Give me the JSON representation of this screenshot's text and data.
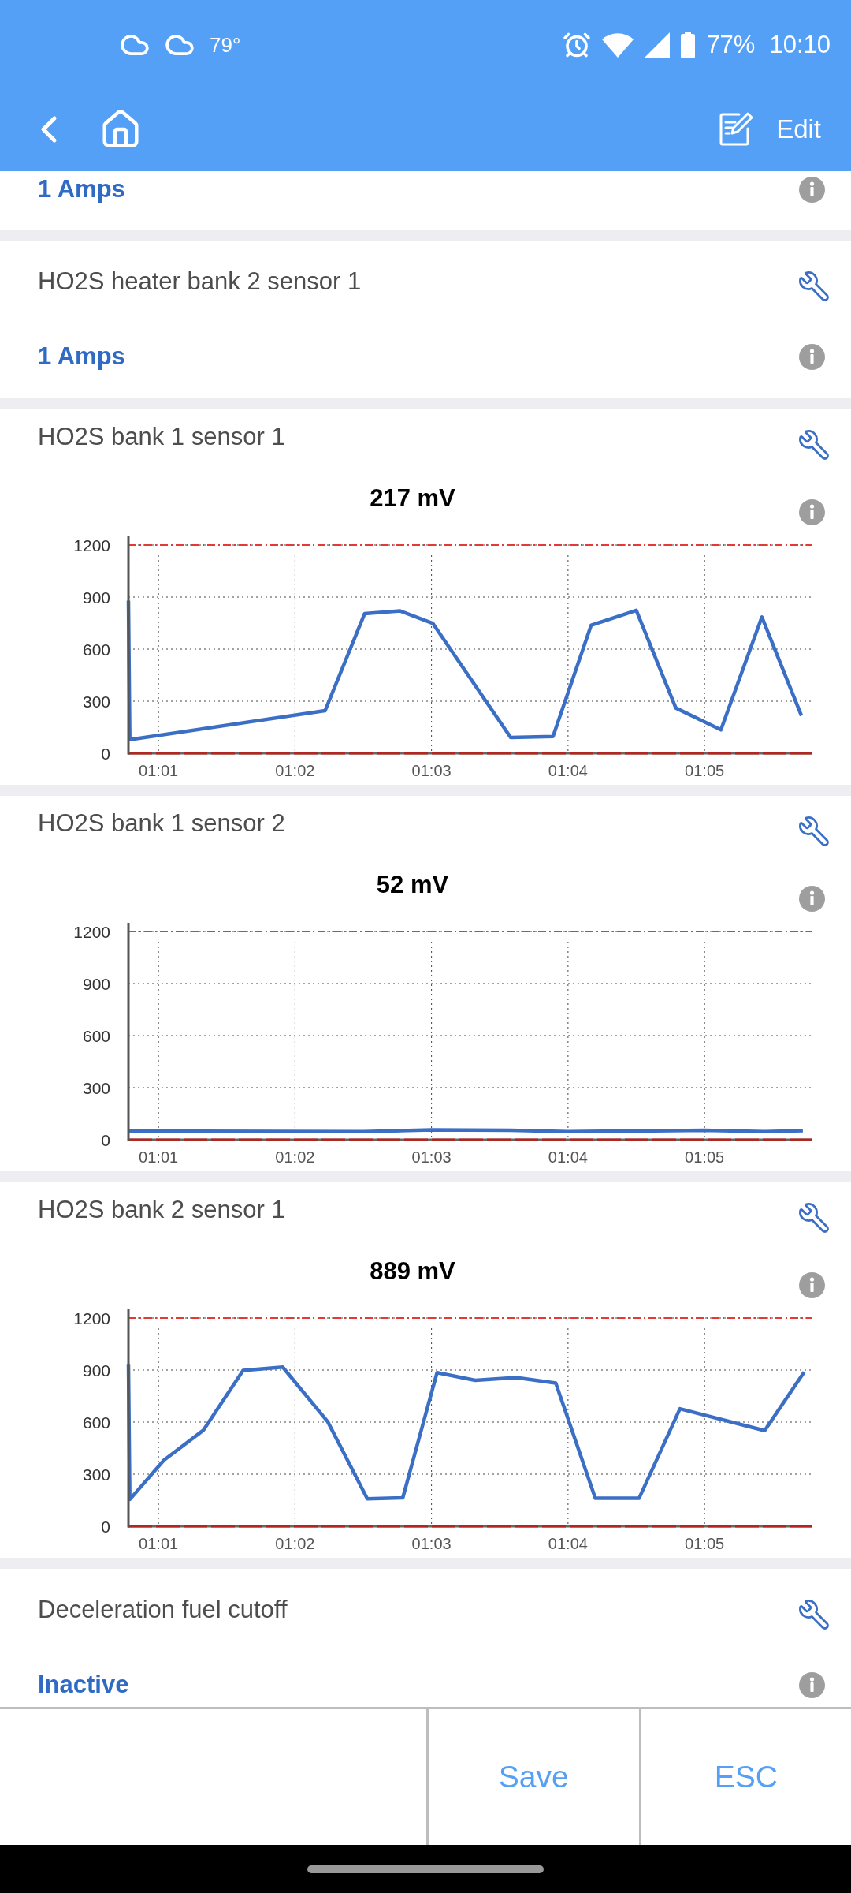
{
  "status_bar": {
    "temperature": "79°",
    "battery": "77%",
    "time": "10:10"
  },
  "toolbar": {
    "edit_label": "Edit"
  },
  "sensors": [
    {
      "kind": "value",
      "value": "1 Amps"
    },
    {
      "kind": "value",
      "title": "HO2S heater bank 2 sensor 1",
      "value": "1 Amps"
    },
    {
      "kind": "chart",
      "title": "HO2S bank 1 sensor 1",
      "reading": "217 mV",
      "chart_data": {
        "type": "line",
        "x": [
          60.78,
          60.79,
          62.22,
          62.51,
          62.77,
          63.01,
          63.58,
          63.89,
          64.17,
          64.5,
          64.79,
          65.12,
          65.42,
          65.71
        ],
        "series": [
          {
            "color": "#3b6fc6",
            "values": [
              880,
              78,
              245,
              804,
              820,
              748,
              91,
              97,
              738,
              823,
              261,
              135,
              785,
              217
            ]
          }
        ],
        "xlim": [
          60.78,
          65.79
        ],
        "ylim": [
          0,
          1250
        ],
        "xticks": [
          {
            "value": 61,
            "label": "01:01"
          },
          {
            "value": 62,
            "label": "01:02"
          },
          {
            "value": 63,
            "label": "01:03"
          },
          {
            "value": 64,
            "label": "01:04"
          },
          {
            "value": 65,
            "label": "01:05"
          }
        ],
        "yticks": [
          0,
          300,
          600,
          900,
          1200
        ],
        "grid": true,
        "ref_lines": [
          {
            "axis": "y",
            "value": 1200,
            "color": "#e53935"
          },
          {
            "axis": "y",
            "value": 0,
            "color": "#b3261e"
          }
        ]
      }
    },
    {
      "kind": "chart",
      "title": "HO2S bank 1 sensor 2",
      "reading": "52 mV",
      "chart_data": {
        "type": "line",
        "x": [
          60.78,
          62.5,
          63,
          63.58,
          64,
          64.5,
          65,
          65.44,
          65.72
        ],
        "series": [
          {
            "color": "#3b6fc6",
            "values": [
              50,
              47,
              57,
              55,
              47,
              50,
              54,
              47,
              52
            ]
          }
        ],
        "xlim": [
          60.78,
          65.79
        ],
        "ylim": [
          0,
          1250
        ],
        "xticks": [
          {
            "value": 61,
            "label": "01:01"
          },
          {
            "value": 62,
            "label": "01:02"
          },
          {
            "value": 63,
            "label": "01:03"
          },
          {
            "value": 64,
            "label": "01:04"
          },
          {
            "value": 65,
            "label": "01:05"
          }
        ],
        "yticks": [
          0,
          300,
          600,
          900,
          1200
        ],
        "grid": true,
        "ref_lines": [
          {
            "axis": "y",
            "value": 1200,
            "color": "#e53935"
          },
          {
            "axis": "y",
            "value": 0,
            "color": "#b3261e"
          }
        ]
      }
    },
    {
      "kind": "chart",
      "title": "HO2S bank 2 sensor 1",
      "reading": "889 mV",
      "chart_data": {
        "type": "line",
        "x": [
          60.78,
          60.79,
          61.04,
          61.33,
          61.62,
          61.91,
          62.24,
          62.53,
          62.79,
          63.04,
          63.32,
          63.62,
          63.91,
          64.2,
          64.52,
          64.82,
          65.44,
          65.73
        ],
        "series": [
          {
            "color": "#3b6fc6",
            "values": [
              935,
              154,
              381,
              554,
              898,
              917,
              602,
              158,
              164,
              885,
              841,
              857,
              825,
              161,
              161,
              677,
              551,
              889
            ]
          }
        ],
        "xlim": [
          60.78,
          65.79
        ],
        "ylim": [
          0,
          1250
        ],
        "xticks": [
          {
            "value": 61,
            "label": "01:01"
          },
          {
            "value": 62,
            "label": "01:02"
          },
          {
            "value": 63,
            "label": "01:03"
          },
          {
            "value": 64,
            "label": "01:04"
          },
          {
            "value": 65,
            "label": "01:05"
          }
        ],
        "yticks": [
          0,
          300,
          600,
          900,
          1200
        ],
        "grid": true,
        "ref_lines": [
          {
            "axis": "y",
            "value": 1200,
            "color": "#e53935"
          },
          {
            "axis": "y",
            "value": 0,
            "color": "#b3261e"
          }
        ]
      }
    },
    {
      "kind": "value",
      "title": "Deceleration fuel cutoff",
      "value": "Inactive"
    }
  ],
  "bottom_bar": {
    "buttons": [
      "Save",
      "ESC"
    ]
  }
}
